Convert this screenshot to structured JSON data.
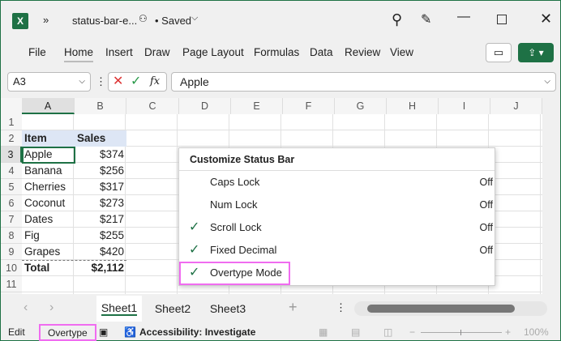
{
  "title_bar": {
    "file_name": "status-bar-e...",
    "save_status": "• Saved"
  },
  "ribbon": {
    "tabs": [
      "File",
      "Home",
      "Insert",
      "Draw",
      "Page Layout",
      "Formulas",
      "Data",
      "Review",
      "View"
    ],
    "active_tab": "Home"
  },
  "formula_bar": {
    "name_box": "A3",
    "formula": "Apple"
  },
  "columns": [
    "A",
    "B",
    "C",
    "D",
    "E",
    "F",
    "G",
    "H",
    "I",
    "J"
  ],
  "rows": [
    "1",
    "2",
    "3",
    "4",
    "5",
    "6",
    "7",
    "8",
    "9",
    "10",
    "11"
  ],
  "table": {
    "headers": [
      "Item",
      "Sales"
    ],
    "data": [
      [
        "Apple",
        "$374"
      ],
      [
        "Banana",
        "$256"
      ],
      [
        "Cherries",
        "$317"
      ],
      [
        "Coconut",
        "$273"
      ],
      [
        "Dates",
        "$217"
      ],
      [
        "Fig",
        "$255"
      ],
      [
        "Grapes",
        "$420"
      ]
    ],
    "total": [
      "Total",
      "$2,112"
    ]
  },
  "context_menu": {
    "title": "Customize Status Bar",
    "items": [
      {
        "label": "Caps Lock",
        "value": "Off",
        "checked": false
      },
      {
        "label": "Num Lock",
        "value": "Off",
        "checked": false
      },
      {
        "label": "Scroll Lock",
        "value": "Off",
        "checked": true
      },
      {
        "label": "Fixed Decimal",
        "value": "Off",
        "checked": true
      },
      {
        "label": "Overtype Mode",
        "value": "",
        "checked": true
      }
    ]
  },
  "sheets": [
    "Sheet1",
    "Sheet2",
    "Sheet3"
  ],
  "active_sheet": "Sheet1",
  "status_bar": {
    "mode": "Edit",
    "overtype": "Overtype",
    "accessibility": "Accessibility: Investigate",
    "zoom": "100%"
  },
  "colors": {
    "accent": "#1e7145",
    "highlight": "#f06cf0"
  }
}
